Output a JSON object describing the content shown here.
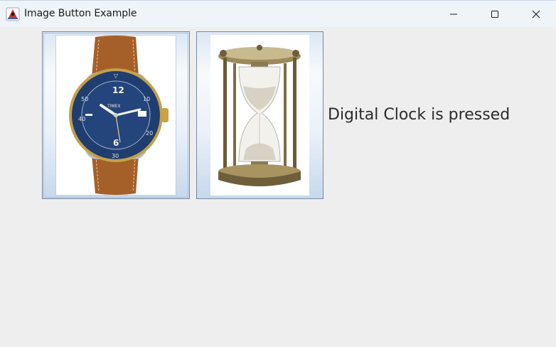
{
  "window": {
    "title": "Image Button Example",
    "icons": {
      "app": "java-duke-icon",
      "minimize": "minimize-icon",
      "maximize": "maximize-icon",
      "close": "close-icon"
    }
  },
  "buttons": [
    {
      "id": "watch",
      "image": "wristwatch-image",
      "state": "focused"
    },
    {
      "id": "hourglass",
      "image": "hourglass-image",
      "state": "normal"
    }
  ],
  "status": {
    "text": "Digital Clock is pressed"
  },
  "colors": {
    "titlebar": "#eff4f9",
    "background": "#eeeeee",
    "dial": "#1f3a6b",
    "strap": "#a5602a",
    "button_border": "#7a8a9c"
  }
}
